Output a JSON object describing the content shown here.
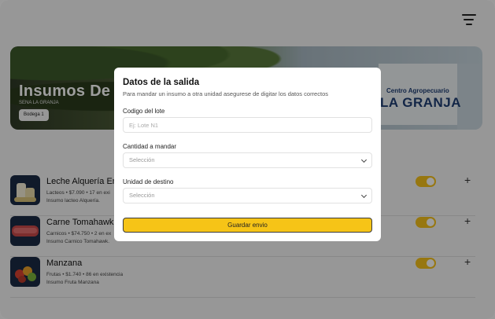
{
  "hero": {
    "title": "Insumos De",
    "subtitle": "SENA LA GRANJA",
    "badge": "Bodega 1",
    "sign_small": "Centro Agropecuario",
    "sign_big": "LA GRANJA"
  },
  "items": [
    {
      "name": "Leche Alquería Ent",
      "meta": "Lacteos • $7.090 • 17 en exi",
      "desc": "Insumo lacteo Alquería.",
      "thumb_color": "#1b2a44",
      "enabled": true
    },
    {
      "name": "Carne Tomahawk",
      "meta": "Carnicos • $74.750 • 2 en ex",
      "desc": "Insumo Carnico Tomahawk.",
      "thumb_color": "#1b2a44",
      "enabled": true
    },
    {
      "name": "Manzana",
      "meta": "Frutas • $1.740 • 86 en existencia",
      "desc": "Insumo Fruta Manzana",
      "thumb_color": "#1b2a44",
      "enabled": true
    }
  ],
  "modal": {
    "title": "Datos de la salida",
    "description": "Para mandar un insumo a otra unidad asegurese de digitar los datos correctos",
    "lote_label": "Codigo del lote",
    "lote_placeholder": "Ej: Lote N1",
    "cantidad_label": "Cantidad a mandar",
    "cantidad_value": "Selección",
    "destino_label": "Unidad de destino",
    "destino_value": "Selección",
    "save_label": "Guardar envio"
  },
  "colors": {
    "accent": "#f6c417",
    "overlay": "rgba(0,0,0,0.38)"
  }
}
